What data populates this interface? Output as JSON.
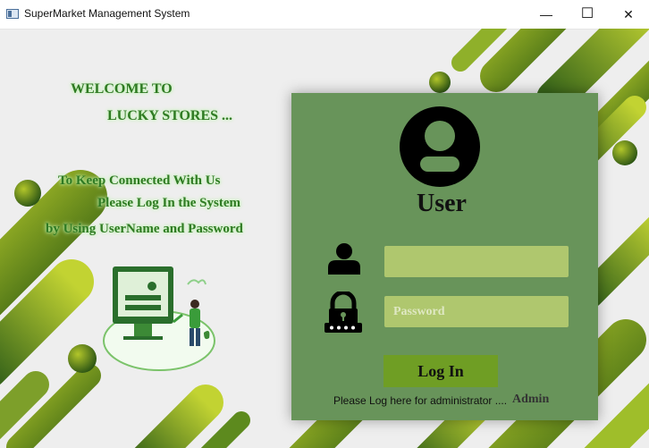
{
  "window": {
    "title": "SuperMarket Management System",
    "minimize_glyph": "—",
    "maximize_glyph": "☐",
    "close_glyph": "✕"
  },
  "welcome": {
    "line1": "WELCOME TO",
    "line2": "LUCKY STORES  ..."
  },
  "message": {
    "line1": "To Keep Connected With Us",
    "line2": "Please Log In the System",
    "line3": "by Using UserName and Password"
  },
  "login": {
    "title": "User",
    "username_value": "",
    "password_placeholder": "Password",
    "button_label": "Log In",
    "admin_note": "Please Log here for administrator ....",
    "admin_link": "Admin"
  },
  "colors": {
    "panel": "#68945a",
    "field": "#afc76e",
    "button": "#6f9e24",
    "accent_green": "#2f7a23"
  },
  "icons": {
    "user": "person-icon",
    "password": "lock-icon"
  }
}
